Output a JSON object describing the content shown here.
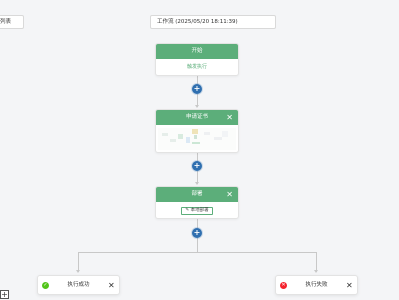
{
  "toolbar": {
    "back_label": "列表"
  },
  "workflow": {
    "title": "工作流 (2025/05/20 18:11:39)"
  },
  "nodes": {
    "start": {
      "title": "开始",
      "status": "触发执行"
    },
    "apply_cert": {
      "title": "申请证书",
      "close": "✕"
    },
    "deploy": {
      "title": "部署",
      "close": "✕",
      "tag": "本地部署"
    }
  },
  "add_button": {
    "label": "+"
  },
  "branches": {
    "success": {
      "label": "执行成功",
      "icon": "✓",
      "close": "✕"
    },
    "failure": {
      "label": "执行失败",
      "icon": "✕",
      "close": "✕"
    }
  },
  "zoom": {
    "label": "+"
  },
  "colors": {
    "node_header": "#5cae7a",
    "add_button": "#2f6fb0",
    "success": "#52c41a",
    "failure": "#f5222d",
    "connector": "#c8c8c8"
  }
}
